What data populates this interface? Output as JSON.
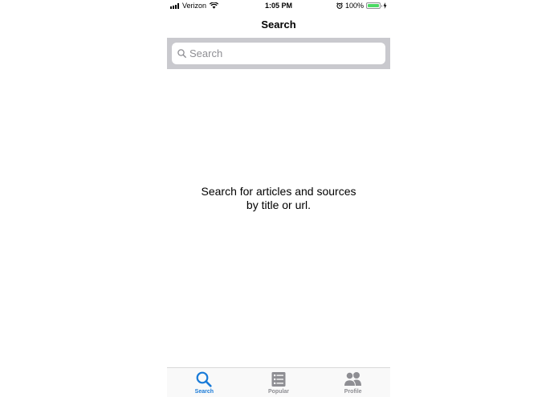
{
  "status_bar": {
    "carrier": "Verizon",
    "time": "1:05 PM",
    "battery_percent": "100%",
    "battery_level": 1.0,
    "battery_color": "#4cd964"
  },
  "nav": {
    "title": "Search"
  },
  "search": {
    "placeholder": "Search",
    "value": ""
  },
  "empty_state": {
    "line1": "Search for articles and sources",
    "line2": "by title or url."
  },
  "tab_bar": {
    "active_color": "#1a7bd8",
    "inactive_color": "#8e8e93",
    "tabs": [
      {
        "label": "Search",
        "icon": "search-icon",
        "active": true
      },
      {
        "label": "Popular",
        "icon": "list-icon",
        "active": false
      },
      {
        "label": "Profile",
        "icon": "people-icon",
        "active": false
      }
    ]
  }
}
